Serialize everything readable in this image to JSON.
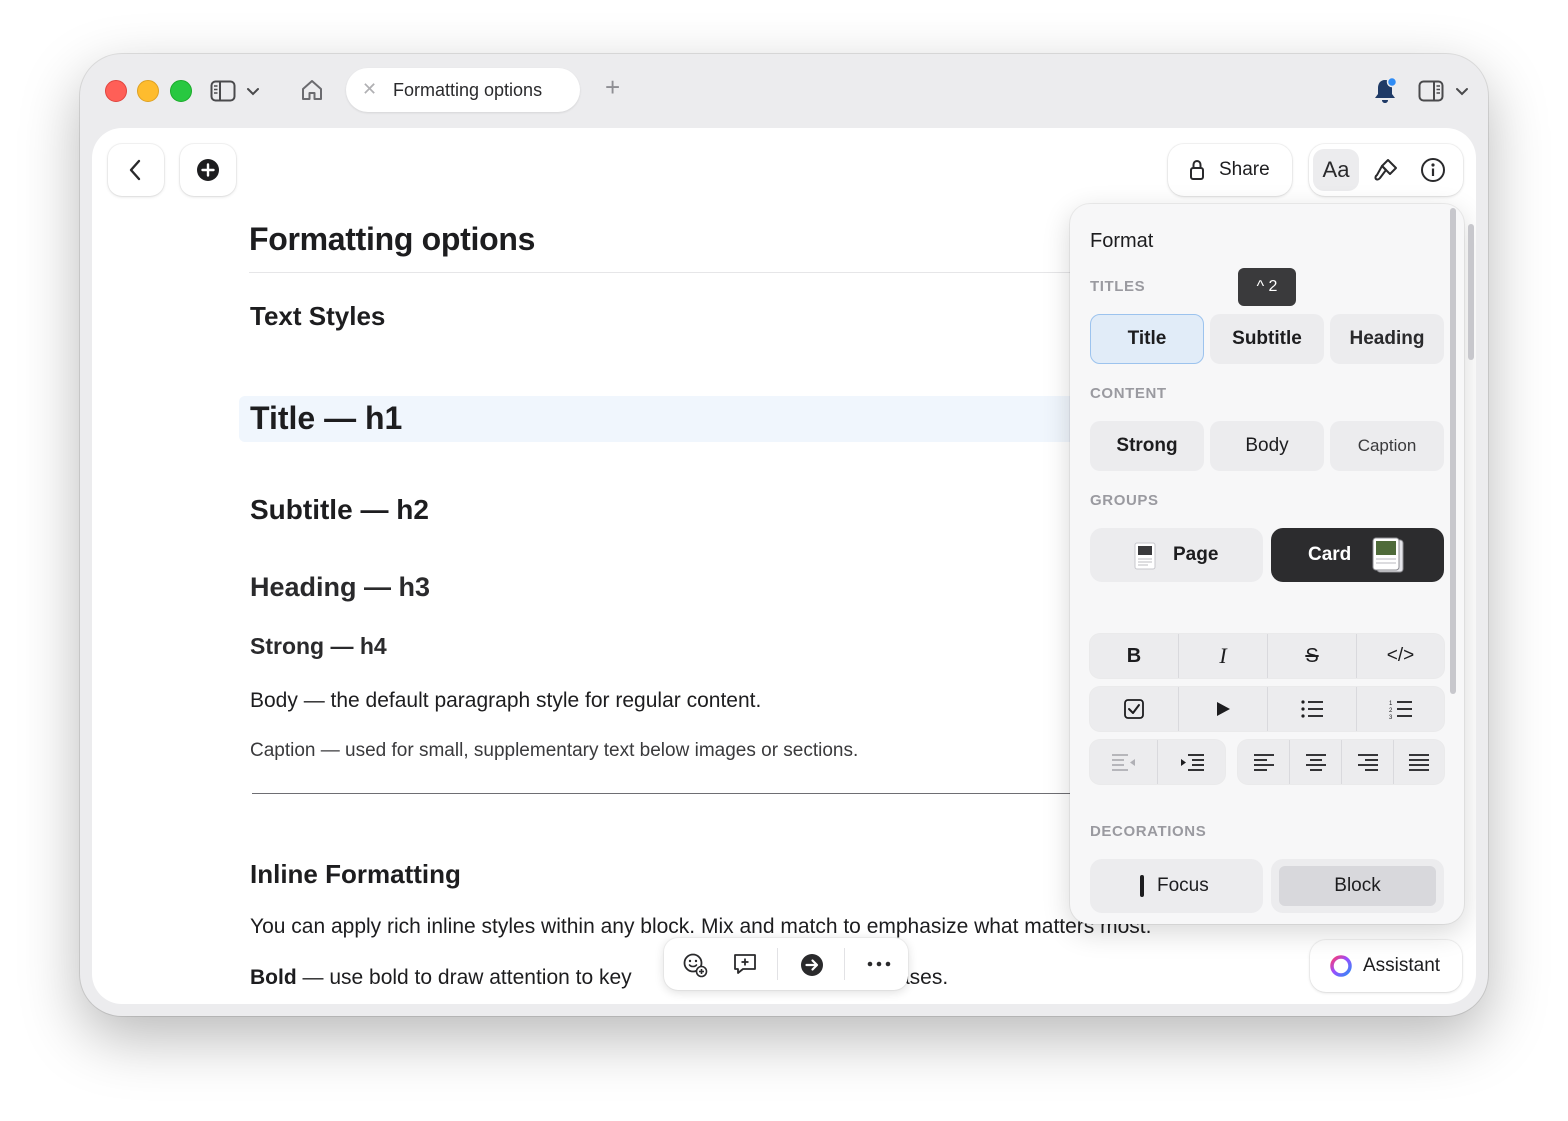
{
  "window": {
    "tab_title": "Formatting options"
  },
  "toolbar": {
    "share_label": "Share",
    "text_style_label": "Aa"
  },
  "document": {
    "title": "Formatting options",
    "section_text_styles": "Text Styles",
    "title_sample": "Title — h1",
    "subtitle_sample": "Subtitle — h2",
    "heading_sample": "Heading — h3",
    "strong_sample": "Strong — h4",
    "body_sample": "Body — the default paragraph style for regular content.",
    "caption_sample": "Caption — used for small, supplementary text below images or sections.",
    "section_inline": "Inline Formatting",
    "inline_paragraph": "You can apply rich inline styles within any block. Mix and match to emphasize what matters most.",
    "bold_prefix": "Bold",
    "bold_rest": " — use bold to draw attention to key",
    "bold_tail": "ases."
  },
  "format_panel": {
    "title": "Format",
    "titles_section": "TITLES",
    "shortcut": "^ 2",
    "title_options": [
      "Title",
      "Subtitle",
      "Heading"
    ],
    "selected_title": "Title",
    "content_section": "CONTENT",
    "content_options": [
      "Strong",
      "Body",
      "Caption"
    ],
    "groups_section": "GROUPS",
    "group_options": [
      "Page",
      "Card"
    ],
    "selected_group": "Card",
    "inline_tools": [
      "bold",
      "italic",
      "strikethrough",
      "code"
    ],
    "bold_glyph": "B",
    "italic_glyph": "I",
    "strike_glyph": "S",
    "code_glyph": "</>",
    "block_tools": [
      "checkbox",
      "toggle",
      "bulleted-list",
      "numbered-list"
    ],
    "align_tools": [
      "outdent",
      "indent",
      "align-left",
      "align-center",
      "align-right",
      "justify"
    ],
    "decorations_section": "DECORATIONS",
    "decoration_options": [
      "Focus",
      "Block"
    ],
    "selected_decoration": "Block"
  },
  "assistant": {
    "label": "Assistant"
  },
  "colors": {
    "selected_title_bg": "#e1ecf8",
    "selected_title_border": "#9cc3ee",
    "selected_group_bg": "#2c2c2e",
    "highlight_row": "#f0f6fd"
  }
}
